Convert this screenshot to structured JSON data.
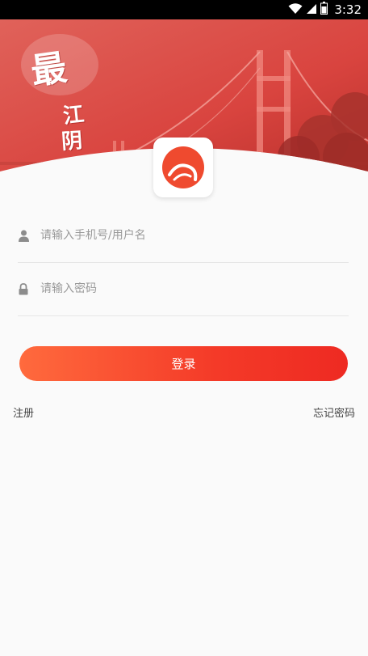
{
  "status_bar": {
    "time": "3:32",
    "icons": [
      "wifi-icon",
      "signal-icon",
      "battery-icon"
    ]
  },
  "header": {
    "calligraphy": {
      "big": "最",
      "line2": "江",
      "line3": "阴"
    }
  },
  "logo": {
    "icon": "app-logo-icon",
    "color": "#ef4a2f"
  },
  "form": {
    "username": {
      "icon": "user-icon",
      "value": "",
      "placeholder": "请输入手机号/用户名"
    },
    "password": {
      "icon": "lock-icon",
      "value": "",
      "placeholder": "请输入密码"
    },
    "login_label": "登录",
    "register_label": "注册",
    "forgot_label": "忘记密码"
  },
  "colors": {
    "accent_start": "#ff6a3d",
    "accent_end": "#ee2a22",
    "banner_red": "#d9443f"
  }
}
